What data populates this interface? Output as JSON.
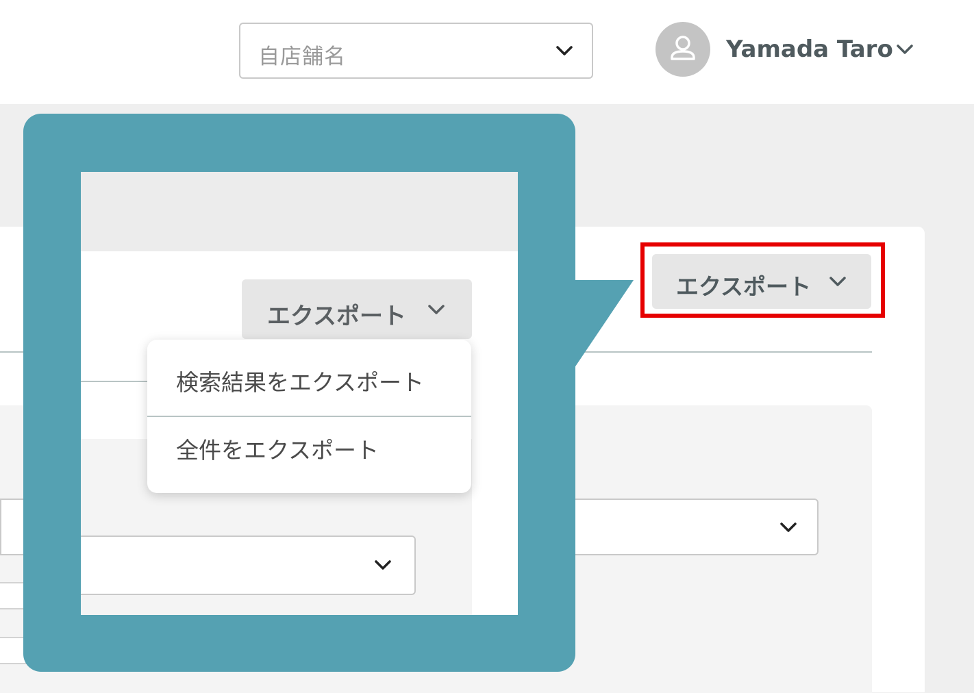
{
  "header": {
    "store_select": {
      "placeholder": "自店舗名"
    },
    "user": {
      "name": "Yamada Taro"
    }
  },
  "page": {
    "export_button": {
      "label": "エクスポート"
    }
  },
  "callout": {
    "export_button": {
      "label": "エクスポート"
    },
    "menu": {
      "items": [
        {
          "label": "検索結果をエクスポート"
        },
        {
          "label": "全件をエクスポート"
        }
      ]
    }
  },
  "colors": {
    "callout_teal": "#55a1b2",
    "highlight_red": "#e60000",
    "header_bg": "#ffffff",
    "page_bg": "#efefef"
  },
  "icons": [
    "chevron-down-icon",
    "user-icon"
  ]
}
